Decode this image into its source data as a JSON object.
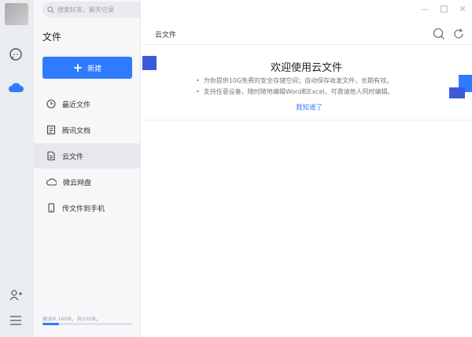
{
  "search": {
    "placeholder": "搜索好友、聊天记录"
  },
  "rail": {
    "icons": [
      "chat-icon",
      "cloud-icon",
      "add-contact-icon",
      "menu-icon"
    ]
  },
  "sidebar": {
    "title": "文件",
    "new_button": "新建",
    "items": [
      {
        "label": "最近文件",
        "icon": "clock-icon"
      },
      {
        "label": "腾讯文档",
        "icon": "doc-icon"
      },
      {
        "label": "云文件",
        "icon": "file-icon",
        "active": true
      },
      {
        "label": "微云网盘",
        "icon": "cloud-drive-icon"
      },
      {
        "label": "传文件到手机",
        "icon": "phone-icon"
      }
    ],
    "storage": {
      "text": "剩余8.16GB，共10GB。",
      "used_fraction": 0.18
    }
  },
  "main": {
    "header_title": "云文件",
    "banner": {
      "title": "欢迎使用云文件",
      "bullets": [
        "为你提供10G免费的安全存储空间；自动保存收发文件，长期有效。",
        "支持任意设备，随时随地编辑Word和Excel，可邀请他人同时编辑。"
      ],
      "ack_link": "我知道了"
    }
  },
  "colors": {
    "accent": "#2f7bff",
    "rail_bg": "#e9ecf0",
    "sidebar_bg": "#f6f7f9",
    "deco_blue": "#3a5bd9"
  }
}
